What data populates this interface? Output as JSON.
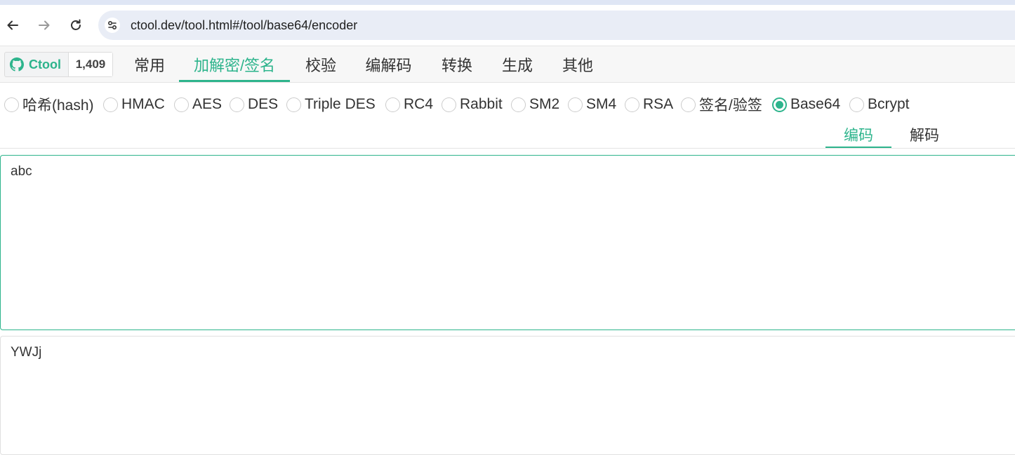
{
  "browser": {
    "url": "ctool.dev/tool.html#/tool/base64/encoder"
  },
  "github_badge": {
    "name": "Ctool",
    "stars": "1,409"
  },
  "main_tabs": [
    {
      "label": "常用"
    },
    {
      "label": "加解密/签名",
      "active": true
    },
    {
      "label": "校验"
    },
    {
      "label": "编解码"
    },
    {
      "label": "转换"
    },
    {
      "label": "生成"
    },
    {
      "label": "其他"
    }
  ],
  "radio_options": [
    {
      "label": "哈希(hash)"
    },
    {
      "label": "HMAC"
    },
    {
      "label": "AES"
    },
    {
      "label": "DES"
    },
    {
      "label": "Triple DES"
    },
    {
      "label": "RC4"
    },
    {
      "label": "Rabbit"
    },
    {
      "label": "SM2"
    },
    {
      "label": "SM4"
    },
    {
      "label": "RSA"
    },
    {
      "label": "签名/验签"
    },
    {
      "label": "Base64",
      "checked": true
    },
    {
      "label": "Bcrypt"
    }
  ],
  "sub_tabs": [
    {
      "label": "编码",
      "active": true
    },
    {
      "label": "解码"
    }
  ],
  "input": {
    "value": "abc"
  },
  "output": {
    "value": "YWJj"
  },
  "colors": {
    "accent": "#2db48c",
    "url_bar_bg": "#e9edf6",
    "header_bg": "#f7f7f7"
  }
}
